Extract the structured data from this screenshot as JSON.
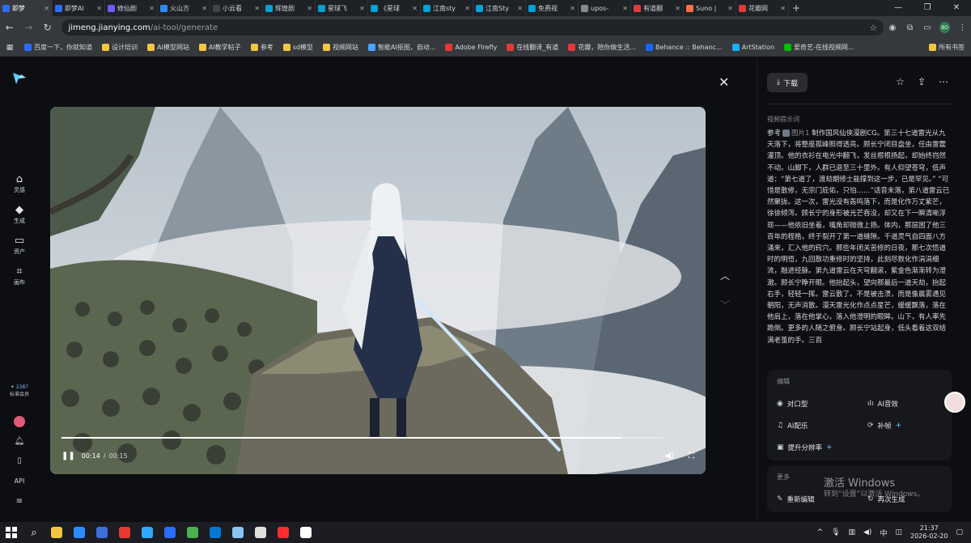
{
  "browser": {
    "tabs": [
      {
        "label": "即梦",
        "color": "#2b6cff",
        "active": true
      },
      {
        "label": "即梦AI",
        "color": "#2b6cff"
      },
      {
        "label": "修仙剧",
        "color": "#6a5cff"
      },
      {
        "label": "火山方",
        "color": "#2d8cff"
      },
      {
        "label": "小云看",
        "color": "#444444"
      },
      {
        "label": "辉煌剧",
        "color": "#00a1d6"
      },
      {
        "label": "星球飞",
        "color": "#00a1d6"
      },
      {
        "label": "《星球",
        "color": "#00a1d6"
      },
      {
        "label": "江南sty",
        "color": "#00a1d6"
      },
      {
        "label": "江南Sty",
        "color": "#00a1d6"
      },
      {
        "label": "免费视",
        "color": "#00a1d6"
      },
      {
        "label": "upos-",
        "color": "#888888"
      },
      {
        "label": "有道翻",
        "color": "#e53935"
      },
      {
        "label": "Suno |",
        "color": "#ff7043"
      },
      {
        "label": "花瓣网",
        "color": "#e53935"
      }
    ],
    "new_tab": "+",
    "window_controls": [
      "—",
      "❐",
      "✕"
    ],
    "url_host": "jimeng.jianying.com",
    "url_path": "/ai-tool/generate",
    "profile_initials": "BO",
    "bookmarks": [
      {
        "label": "百度一下，你就知道",
        "color": "#2b6cff"
      },
      {
        "label": "设计培训",
        "color": "#f5c542"
      },
      {
        "label": "AI模型网站",
        "color": "#f5c542"
      },
      {
        "label": "AI教学帖子",
        "color": "#f5c542"
      },
      {
        "label": "参考",
        "color": "#f5c542"
      },
      {
        "label": "sd模型",
        "color": "#f5c542"
      },
      {
        "label": "视频网站",
        "color": "#f5c542"
      },
      {
        "label": "智能AI抠图，自动...",
        "color": "#4aa3ff"
      },
      {
        "label": "Adobe Firefly",
        "color": "#e53935"
      },
      {
        "label": "在线翻译_有道",
        "color": "#e53935"
      },
      {
        "label": "花瓣，陪你做生活...",
        "color": "#e53935"
      },
      {
        "label": "Behance :: Behanc...",
        "color": "#1769ff"
      },
      {
        "label": "ArtStation",
        "color": "#13aff0"
      },
      {
        "label": "爱奇艺-在线视频网...",
        "color": "#00be06"
      }
    ],
    "all_bookmarks": "所有书签"
  },
  "sidebar": {
    "items": [
      {
        "label": "灵感",
        "icon": "home-icon"
      },
      {
        "label": "生成",
        "icon": "sparkle-icon"
      },
      {
        "label": "资产",
        "icon": "folder-icon"
      },
      {
        "label": "画布",
        "icon": "canvas-icon"
      }
    ],
    "credits": "2387",
    "member_label": "标准会员",
    "api_label": "API"
  },
  "player": {
    "current_time": "00:14",
    "separator": "/",
    "duration": "00:15",
    "progress": 0.93
  },
  "panel": {
    "download_label": "下载",
    "prompt_label": "视频提示词",
    "prompt_prefix": "参考",
    "prompt_image_ref": "图片1",
    "prompt_text": "制作国风仙侠漫剧CG。第三十七道雷光从九天落下，将整座孤峰照得透亮。顾长宁闭目盘坐，任由雷霆灌顶。他的衣衫在电光中翻飞，发丝根根扬起，却始终岿然不动。山脚下，人群已退至三十里外。有人仰望苍穹，低声道：“第七道了，渡劫期修士能撑到这一步，已是罕见。” “可惜是散修，无宗门庇佑，只怕……”话音未落，第八道雷云已然聚拢。这一次，雷光没有轰鸣落下，而是化作万丈紫芒，徐徐倾泻。顾长宁的身形被光芒吞没，却又在下一瞬清晰浮现——他依旧坐着，嘴角却微微上扬。体内，那层困了他三百年的桎梏，终于裂开了第一道缝隙。千道灵气自四面八方涌来，汇入他的窍穴。那些年闭关苦修的日夜，那七次悟道时的明悟，九回散功重修时的坚持，此刻尽数化作涓涓细流，融进经脉。第九道雷云在天穹翻滚，紫金色渐渐转为澄澈。顾长宁睁开眼。他抬起头，望向那最后一道天劫，抬起右手，轻轻一挥。雷云散了。不是被击溃，而是像晨雾遇见朝阳，无声消散。漫天雷光化作点点星芒，缓缓飘落，落在他肩上，落在他掌心，落入他澄明的眼眸。山下，有人率先跪倒。更多的人随之俯身。顾长宁站起身，低头看着这双结满老茧的手。三百",
    "edit_card": {
      "title": "编辑",
      "items": [
        {
          "label": "对口型",
          "icon": "eye-icon",
          "plus": false
        },
        {
          "label": "AI音效",
          "icon": "sound-icon",
          "plus": false
        },
        {
          "label": "AI配乐",
          "icon": "music-icon",
          "plus": false
        },
        {
          "label": "补帧",
          "icon": "frame-icon",
          "plus": true
        },
        {
          "label": "提升分辨率",
          "icon": "hd-icon",
          "plus": true
        }
      ],
      "plus_symbol": "+"
    },
    "more_card": {
      "title": "更多",
      "items": [
        {
          "label": "重新编辑",
          "icon": "edit-icon"
        },
        {
          "label": "再次生成",
          "icon": "refresh-icon"
        }
      ]
    }
  },
  "watermark": {
    "title": "激活 Windows",
    "subtitle": "转到“设置”以激活 Windows。"
  },
  "taskbar": {
    "apps": [
      "#f5c542",
      "#2d8cff",
      "#3c6fd8",
      "#e53935",
      "#31a8ff",
      "#2b6cff",
      "#4caf50",
      "#0078d4",
      "#89c4f4",
      "#e0e0e0",
      "#ff2d2d",
      "#ffffff"
    ],
    "lang": "中",
    "time": "21:37",
    "date": "2026-02-20"
  }
}
